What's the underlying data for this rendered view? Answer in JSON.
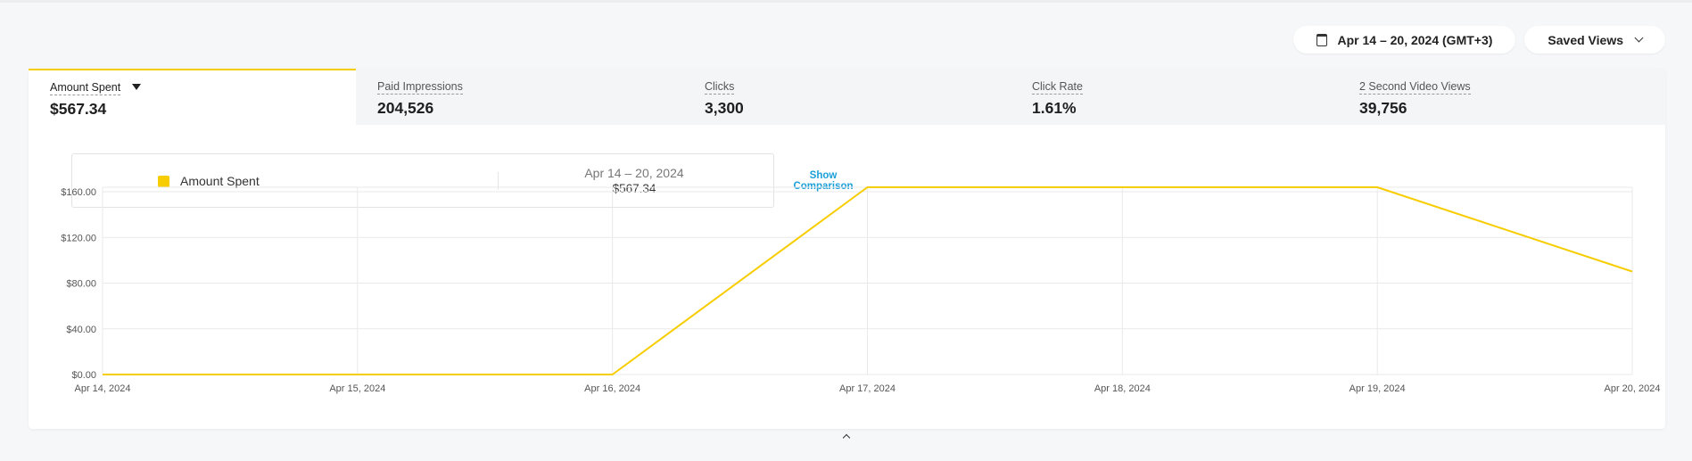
{
  "date_range": {
    "label": "Apr 14 – 20, 2024 (GMT+3)"
  },
  "saved_views": {
    "label": "Saved Views"
  },
  "tabs": [
    {
      "label": "Amount Spent",
      "value": "$567.34"
    },
    {
      "label": "Paid Impressions",
      "value": "204,526"
    },
    {
      "label": "Clicks",
      "value": "3,300"
    },
    {
      "label": "Click Rate",
      "value": "1.61%"
    },
    {
      "label": "2 Second Video Views",
      "value": "39,756"
    }
  ],
  "legend": {
    "series_name": "Amount Spent",
    "period": "Apr 14 – 20, 2024",
    "total": "$567.34",
    "show_comparison": "Show Comparison"
  },
  "colors": {
    "series": "#f8cd00",
    "grid": "#e9e9e9",
    "axis_text": "#555555"
  },
  "chart_data": {
    "type": "line",
    "categories": [
      "Apr 14, 2024",
      "Apr 15, 2024",
      "Apr 16, 2024",
      "Apr 17, 2024",
      "Apr 18, 2024",
      "Apr 19, 2024",
      "Apr 20, 2024"
    ],
    "series": [
      {
        "name": "Amount Spent",
        "values": [
          0,
          0,
          0,
          160,
          160,
          160,
          88
        ]
      }
    ],
    "yticks": [
      "$0.00",
      "$40.00",
      "$80.00",
      "$120.00",
      "$160.00"
    ],
    "ylim": [
      0,
      160
    ],
    "grid": true
  }
}
